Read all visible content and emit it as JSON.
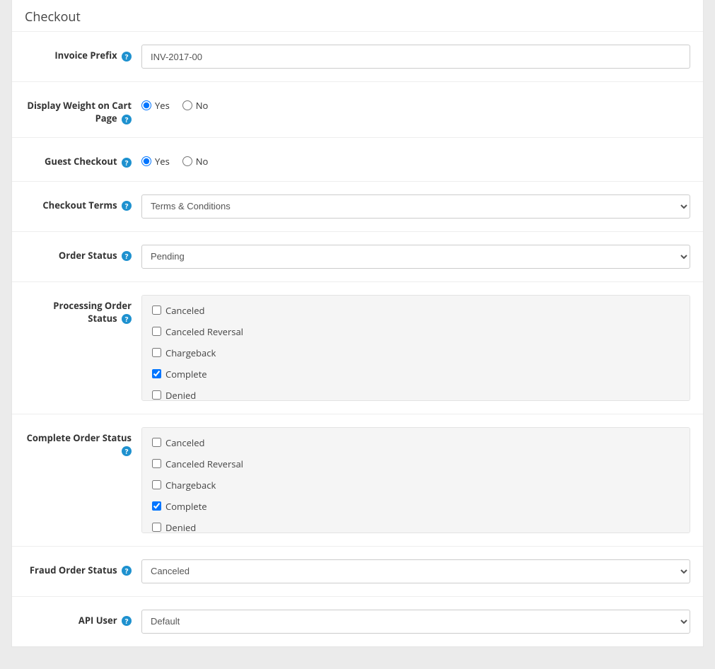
{
  "section_title": "Checkout",
  "radio_yes": "Yes",
  "radio_no": "No",
  "help_glyph": "?",
  "fields": {
    "invoice_prefix": {
      "label": "Invoice Prefix",
      "value": "INV-2017-00"
    },
    "display_weight": {
      "label": "Display Weight on Cart Page",
      "selected": "yes"
    },
    "guest_checkout": {
      "label": "Guest Checkout",
      "selected": "yes"
    },
    "checkout_terms": {
      "label": "Checkout Terms",
      "value": "Terms & Conditions"
    },
    "order_status": {
      "label": "Order Status",
      "value": "Pending"
    },
    "processing_order_status": {
      "label": "Processing Order Status",
      "options": [
        {
          "label": "Canceled",
          "checked": false
        },
        {
          "label": "Canceled Reversal",
          "checked": false
        },
        {
          "label": "Chargeback",
          "checked": false
        },
        {
          "label": "Complete",
          "checked": true
        },
        {
          "label": "Denied",
          "checked": false
        }
      ]
    },
    "complete_order_status": {
      "label": "Complete Order Status",
      "options": [
        {
          "label": "Canceled",
          "checked": false
        },
        {
          "label": "Canceled Reversal",
          "checked": false
        },
        {
          "label": "Chargeback",
          "checked": false
        },
        {
          "label": "Complete",
          "checked": true
        },
        {
          "label": "Denied",
          "checked": false
        }
      ]
    },
    "fraud_order_status": {
      "label": "Fraud Order Status",
      "value": "Canceled"
    },
    "api_user": {
      "label": "API User",
      "value": "Default"
    }
  }
}
